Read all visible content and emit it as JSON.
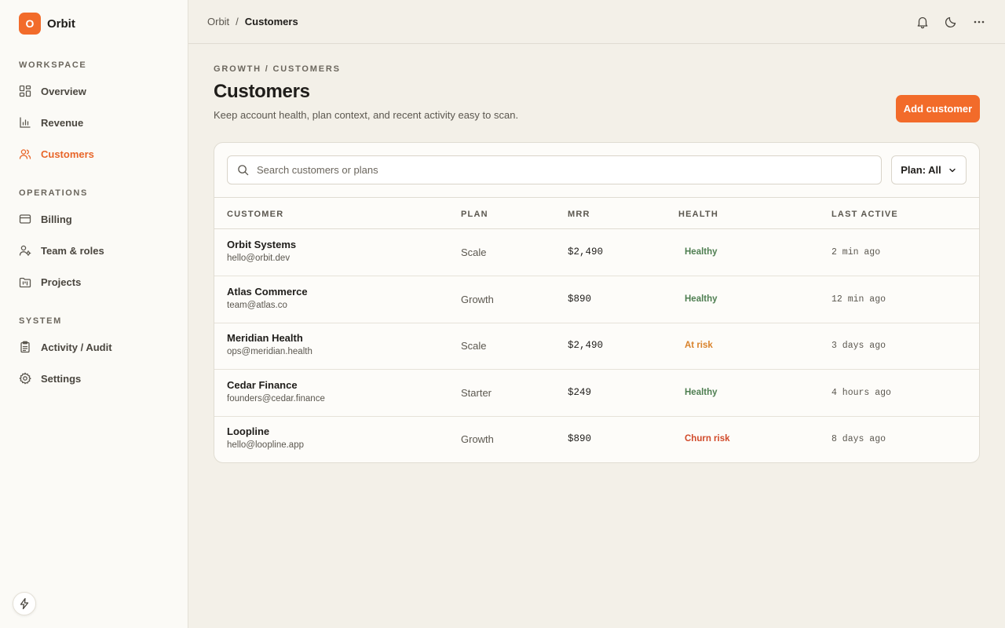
{
  "brand": {
    "logo_letter": "O",
    "name": "Orbit"
  },
  "sidebar": {
    "sections": [
      {
        "label": "Workspace",
        "items": [
          {
            "label": "Overview",
            "icon": "dashboard-icon",
            "active": false
          },
          {
            "label": "Revenue",
            "icon": "bar-chart-icon",
            "active": false
          },
          {
            "label": "Customers",
            "icon": "users-icon",
            "active": true
          }
        ]
      },
      {
        "label": "Operations",
        "items": [
          {
            "label": "Billing",
            "icon": "credit-card-icon",
            "active": false
          },
          {
            "label": "Team & roles",
            "icon": "user-cog-icon",
            "active": false
          },
          {
            "label": "Projects",
            "icon": "folder-kanban-icon",
            "active": false
          }
        ]
      },
      {
        "label": "System",
        "items": [
          {
            "label": "Activity / Audit",
            "icon": "clipboard-icon",
            "active": false
          },
          {
            "label": "Settings",
            "icon": "gear-icon",
            "active": false
          }
        ]
      }
    ]
  },
  "topbar": {
    "breadcrumb_root": "Orbit",
    "breadcrumb_sep": "/",
    "breadcrumb_current": "Customers",
    "icons": [
      "bell-icon",
      "moon-icon",
      "more-horizontal-icon"
    ]
  },
  "header": {
    "eyebrow": "GROWTH / CUSTOMERS",
    "title": "Customers",
    "subtitle": "Keep account health, plan context, and recent activity easy to scan.",
    "add_button": "Add customer"
  },
  "filters": {
    "search_placeholder": "Search customers or plans",
    "search_value": "",
    "plan_select": "Plan: All"
  },
  "table": {
    "columns": [
      "Customer",
      "Plan",
      "MRR",
      "Health",
      "Last active"
    ],
    "rows": [
      {
        "name": "Orbit Systems",
        "email": "hello@orbit.dev",
        "plan": "Scale",
        "mrr": "$2,490",
        "health": "Healthy",
        "last_active": "2 min ago"
      },
      {
        "name": "Atlas Commerce",
        "email": "team@atlas.co",
        "plan": "Growth",
        "mrr": "$890",
        "health": "Healthy",
        "last_active": "12 min ago"
      },
      {
        "name": "Meridian Health",
        "email": "ops@meridian.health",
        "plan": "Scale",
        "mrr": "$2,490",
        "health": "At risk",
        "last_active": "3 days ago"
      },
      {
        "name": "Cedar Finance",
        "email": "founders@cedar.finance",
        "plan": "Starter",
        "mrr": "$249",
        "health": "Healthy",
        "last_active": "4 hours ago"
      },
      {
        "name": "Loopline",
        "email": "hello@loopline.app",
        "plan": "Growth",
        "mrr": "$890",
        "health": "Churn risk",
        "last_active": "8 days ago"
      }
    ]
  },
  "colors": {
    "accent": "#f26b2a",
    "healthy": "#4f7f52",
    "at_risk": "#d9822b",
    "churn_risk": "#d14a2a"
  }
}
